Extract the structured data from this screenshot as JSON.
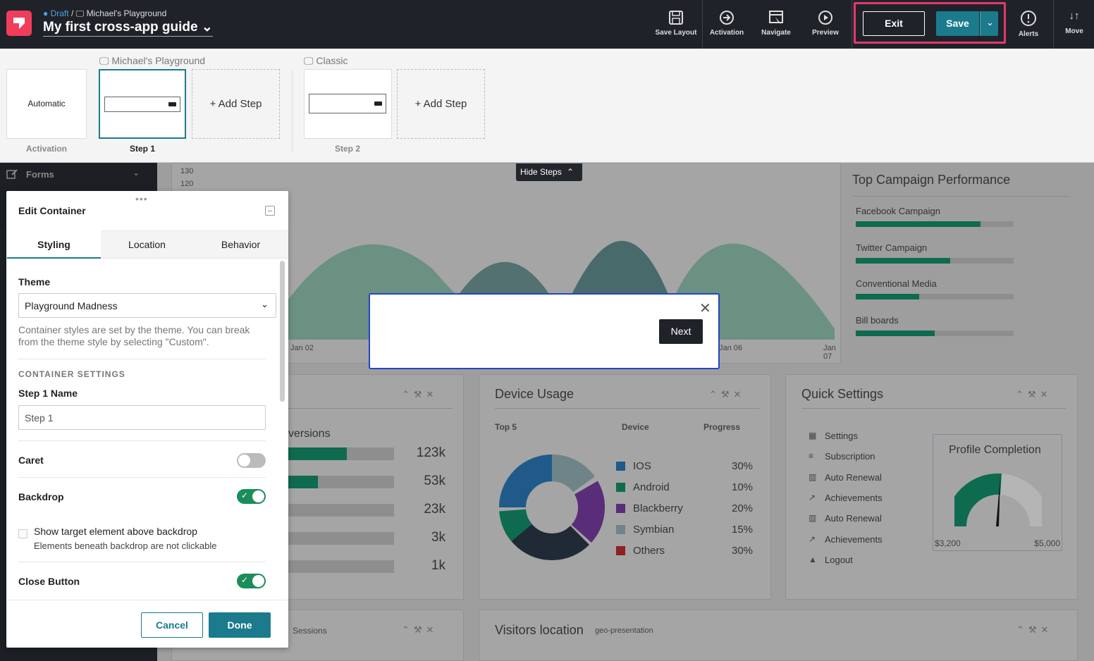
{
  "topbar": {
    "status": "Draft",
    "separator": "/",
    "app_name": "Michael's Playground",
    "guide_title": "My first cross-app guide",
    "actions": [
      "Save Layout",
      "Activation",
      "Navigate",
      "Preview"
    ],
    "exit_label": "Exit",
    "save_label": "Save",
    "alerts_label": "Alerts",
    "move_label": "Move",
    "highlight_color": "#e5386e"
  },
  "steps": {
    "group1_app": "Michael's Playground",
    "group2_app": "Classic",
    "activation_card": "Automatic",
    "activation_caption": "Activation",
    "step1_caption": "Step 1",
    "step2_caption": "Step 2",
    "add_step": "+ Add Step",
    "hide_steps": "Hide Steps"
  },
  "dashboard": {
    "sidebar_forms": "Forms",
    "y_ticks": [
      "130",
      "120"
    ],
    "x_ticks": [
      "Jan 02",
      "Jan 06",
      "Jan 07"
    ],
    "campaign_title": "Top Campaign Performance",
    "campaigns": [
      {
        "name": "Facebook Campaign",
        "value": 0.79
      },
      {
        "name": "Twitter Campaign",
        "value": 0.6
      },
      {
        "name": "Conventional Media",
        "value": 0.4
      },
      {
        "name": "Bill boards",
        "value": 0.5
      }
    ],
    "conversions_label": "versions",
    "conversion_values": [
      "123k",
      "53k",
      "23k",
      "3k",
      "1k"
    ],
    "conversion_fills": [
      0.55,
      0.28,
      0,
      0,
      0
    ],
    "device_title": "Device Usage",
    "device_headers": [
      "Top 5",
      "Device",
      "Progress"
    ],
    "devices": [
      {
        "name": "IOS",
        "pct": "30%",
        "color": "#1f5a8a"
      },
      {
        "name": "Android",
        "pct": "10%",
        "color": "#0e6b4f"
      },
      {
        "name": "Blackberry",
        "pct": "20%",
        "color": "#5a2d7a"
      },
      {
        "name": "Symbian",
        "pct": "15%",
        "color": "#6f8488"
      },
      {
        "name": "Others",
        "pct": "30%",
        "color": "#8c2222"
      }
    ],
    "quick_title": "Quick Settings",
    "quick_items": [
      "Settings",
      "Subscription",
      "Auto Renewal",
      "Achievements",
      "Auto Renewal",
      "Achievements",
      "Logout"
    ],
    "profile_title": "Profile Completion",
    "profile_min": "$3,200",
    "profile_max": "$5,000",
    "sessions_label": "Sessions",
    "visitors_title": "Visitors location",
    "visitors_sub": "geo-presentation"
  },
  "edit": {
    "title": "Edit Container",
    "tabs": [
      "Styling",
      "Location",
      "Behavior"
    ],
    "theme_label": "Theme",
    "theme_value": "Playground Madness",
    "theme_help": "Container styles are set by the theme. You can break from the theme style by selecting \"Custom\".",
    "section": "CONTAINER SETTINGS",
    "name_label": "Step 1 Name",
    "name_value": "Step 1",
    "caret_label": "Caret",
    "backdrop_label": "Backdrop",
    "show_target_label": "Show target element above backdrop",
    "show_target_help": "Elements beneath backdrop are not clickable",
    "close_label": "Close Button",
    "cancel": "Cancel",
    "done": "Done"
  },
  "modal": {
    "next_label": "Next"
  }
}
